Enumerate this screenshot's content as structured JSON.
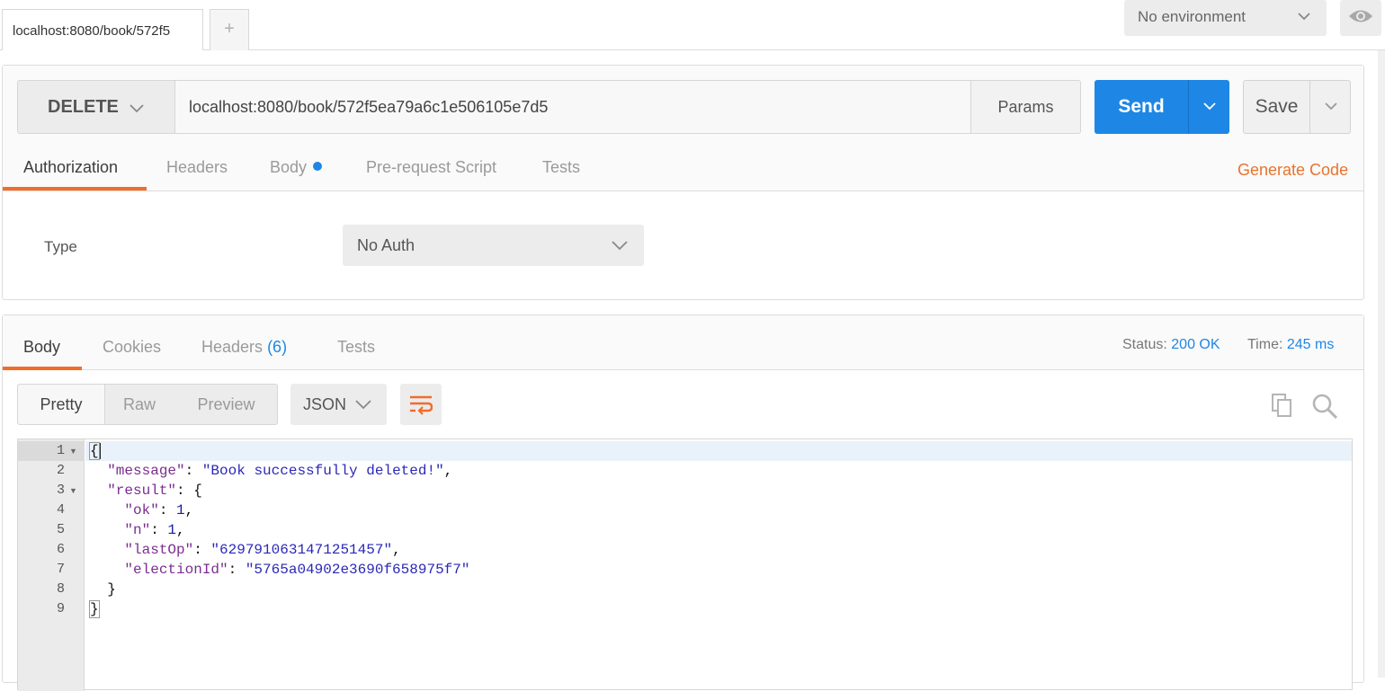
{
  "tabs": {
    "active_request": "localhost:8080/book/572f5",
    "new_tab_glyph": "+"
  },
  "environment": {
    "selected": "No environment"
  },
  "request": {
    "method": "DELETE",
    "url": "localhost:8080/book/572f5ea79a6c1e506105e7d5",
    "params_label": "Params",
    "send_label": "Send",
    "save_label": "Save",
    "tabs": [
      "Authorization",
      "Headers",
      "Body",
      "Pre-request Script",
      "Tests"
    ],
    "active_tab": "Authorization",
    "generate_code_label": "Generate Code",
    "auth": {
      "type_label": "Type",
      "selected": "No Auth"
    }
  },
  "response": {
    "tabs": {
      "body": "Body",
      "cookies": "Cookies",
      "headers": "Headers",
      "headers_count": "(6)",
      "tests": "Tests"
    },
    "status_label": "Status:",
    "status_value": "200 OK",
    "time_label": "Time:",
    "time_value": "245 ms",
    "views": [
      "Pretty",
      "Raw",
      "Preview"
    ],
    "active_view": "Pretty",
    "format": "JSON",
    "code_lines": [
      {
        "n": "1",
        "fold": true
      },
      {
        "n": "2",
        "key": "\"message\"",
        "value": "\"Book successfully deleted!\"",
        "trail": ","
      },
      {
        "n": "3",
        "fold": true,
        "key": "\"result\"",
        "open": "{"
      },
      {
        "n": "4",
        "key": "\"ok\"",
        "value": "1",
        "trail": ","
      },
      {
        "n": "5",
        "key": "\"n\"",
        "value": "1",
        "trail": ","
      },
      {
        "n": "6",
        "key": "\"lastOp\"",
        "value": "\"6297910631471251457\"",
        "trail": ","
      },
      {
        "n": "7",
        "key": "\"electionId\"",
        "value": "\"5765a04902e3690f658975f7\""
      },
      {
        "n": "8",
        "close": "}"
      },
      {
        "n": "9",
        "close": "}"
      }
    ]
  },
  "icons": {
    "chevron": "chevron-down-icon",
    "eye": "eye-icon",
    "wrap": "wrap-lines-icon",
    "copy": "copy-icon",
    "search": "search-icon"
  },
  "colors": {
    "accent_orange": "#f06d2c",
    "send_blue": "#1e87e5"
  }
}
